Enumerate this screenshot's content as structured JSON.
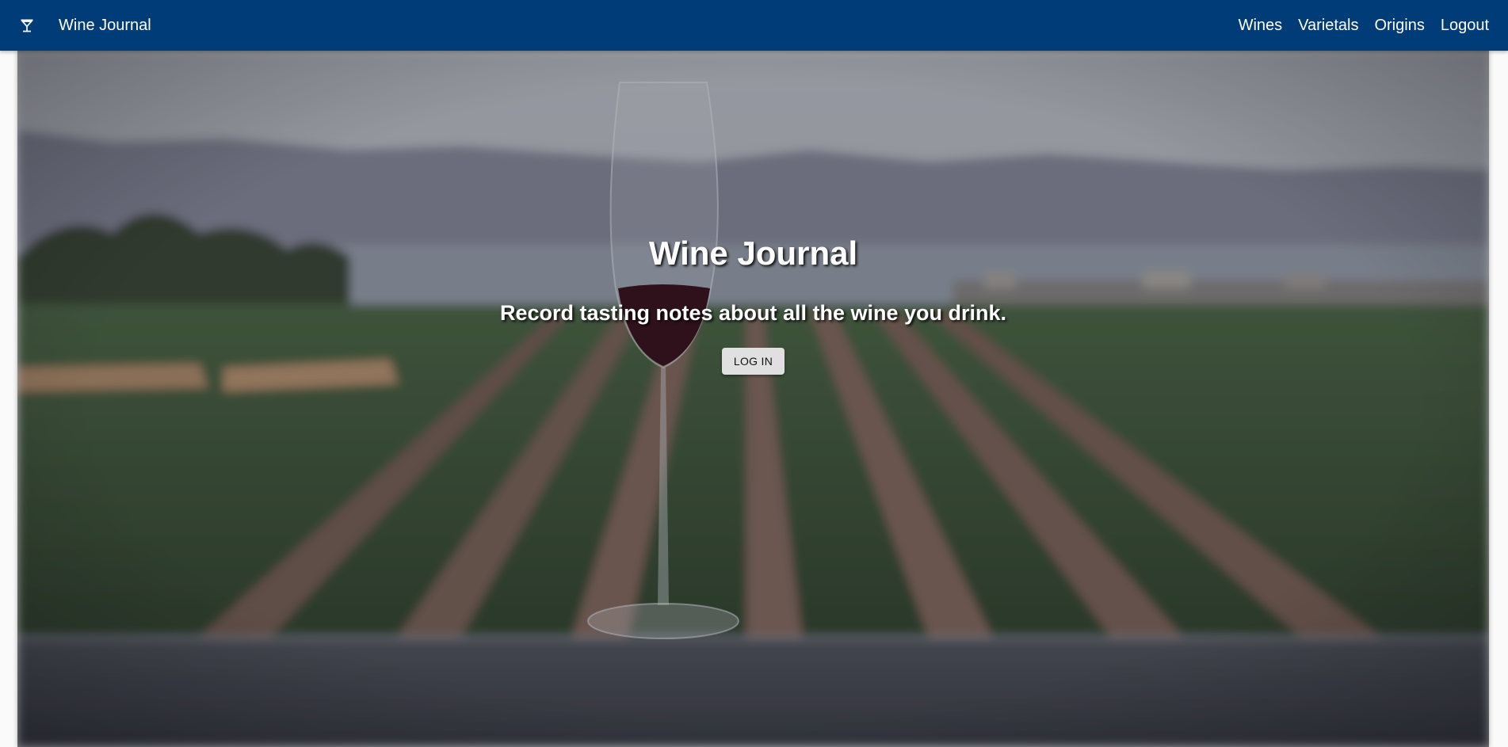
{
  "appbar": {
    "icon": "cocktail-glass-icon",
    "title": "Wine Journal",
    "nav": [
      {
        "label": "Wines"
      },
      {
        "label": "Varietals"
      },
      {
        "label": "Origins"
      },
      {
        "label": "Logout"
      }
    ],
    "color": "#003c78"
  },
  "hero": {
    "title": "Wine Journal",
    "subtitle": "Record tasting notes about all the wine you drink.",
    "login_label": "LOG IN",
    "image": "wine-glass-vineyard-photo"
  }
}
